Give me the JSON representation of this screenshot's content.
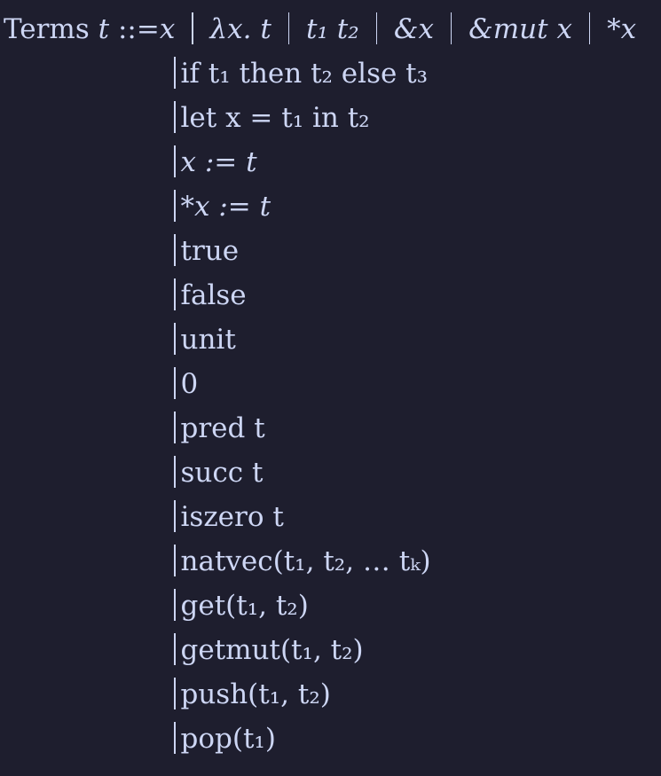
{
  "header": {
    "label": "Terms",
    "metavar": "t",
    "defines": "::=",
    "alt_separator": "|"
  },
  "first_line_alternatives": [
    "x",
    "λx. t",
    "t₁ t₂",
    "&x",
    "&mut x",
    "*x"
  ],
  "alternatives": [
    "if t₁ then t₂ else t₃",
    "let x = t₁ in t₂",
    "x := t",
    "*x := t",
    "true",
    "false",
    "unit",
    "0",
    "pred t",
    "succ t",
    "iszero t",
    "natvec(t₁, t₂, … tₖ)",
    "get(t₁, t₂)",
    "getmut(t₁, t₂)",
    "push(t₁, t₂)",
    "pop(t₁)"
  ],
  "colors": {
    "background": "#1e1e2e",
    "text": "#cdd6f4"
  }
}
